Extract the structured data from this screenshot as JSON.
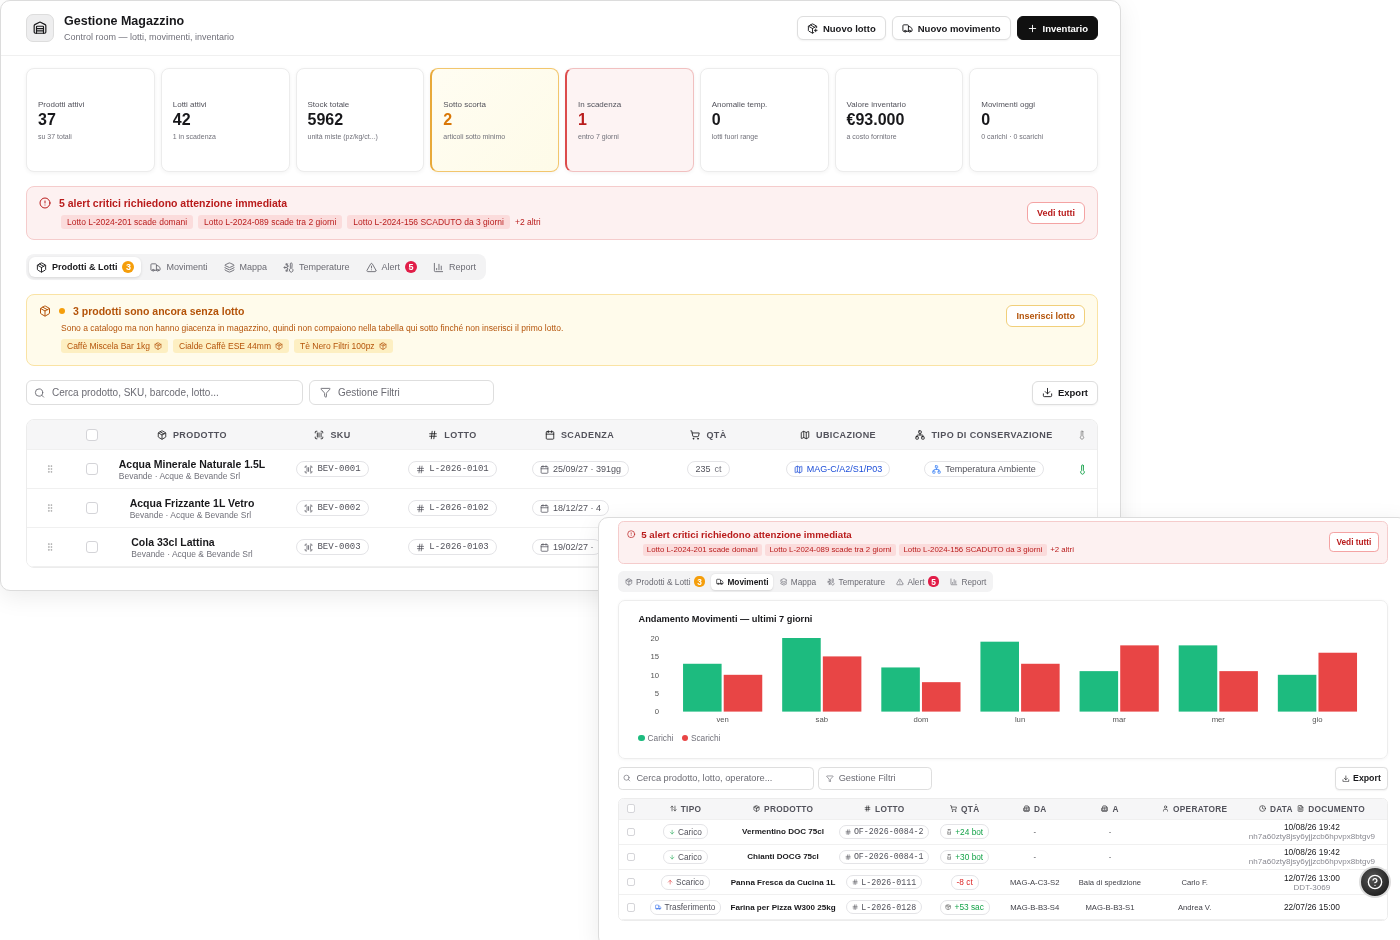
{
  "main_window": {
    "title": "Gestione Magazzino",
    "subtitle": "Control room — lotti, movimenti, inventario",
    "actions": [
      {
        "label": "Nuovo lotto",
        "kind": "outline"
      },
      {
        "label": "Nuovo movimento",
        "kind": "outline"
      },
      {
        "label": "Inventario",
        "kind": "primary"
      }
    ],
    "stats": [
      {
        "label": "Prodotti attivi",
        "value": "37",
        "note": "su 37 totali",
        "kind": "normal"
      },
      {
        "label": "Lotti attivi",
        "value": "42",
        "note": "1 in scadenza",
        "kind": "normal"
      },
      {
        "label": "Stock totale",
        "value": "5962",
        "note": "unità miste (pz/kg/ct...)",
        "kind": "normal"
      },
      {
        "label": "Sotto scorta",
        "value": "2",
        "note": "articoli sotto minimo",
        "kind": "warning"
      },
      {
        "label": "In scadenza",
        "value": "1",
        "note": "entro 7 giorni",
        "kind": "danger"
      },
      {
        "label": "Anomalie temp.",
        "value": "0",
        "note": "lotti fuori range",
        "kind": "normal"
      },
      {
        "label": "Valore inventario",
        "value": "€93.000",
        "note": "a costo fornitore",
        "kind": "normal"
      },
      {
        "label": "Movimenti oggi",
        "value": "0",
        "note": "0 carichi · 0 scarichi",
        "kind": "normal"
      }
    ],
    "alert": {
      "title": "5 alert critici richiedono attenzione immediata",
      "chips": [
        "Lotto L-2024-201 scade domani",
        "Lotto L-2024-089 scade tra 2 giorni",
        "Lotto L-2024-156 SCADUTO da 3 giorni"
      ],
      "more": "+2 altri",
      "button": "Vedi tutti"
    },
    "tabs": [
      {
        "label": "Prodotti & Lotti",
        "selected": true,
        "badge": {
          "text": "3",
          "color": "#f59e0b"
        }
      },
      {
        "label": "Movimenti",
        "selected": false
      },
      {
        "label": "Mappa",
        "selected": false
      },
      {
        "label": "Temperature",
        "selected": false
      },
      {
        "label": "Alert",
        "selected": false,
        "badge": {
          "text": "5",
          "color": "#e11d48"
        }
      },
      {
        "label": "Report",
        "selected": false
      }
    ],
    "notice": {
      "title": "3 prodotti sono ancora senza lotto",
      "text": "Sono a catalogo ma non hanno giacenza in magazzino, quindi non compaiono nella tabella qui sotto finché non inserisci il primo lotto.",
      "chips": [
        "Caffè Miscela Bar 1kg",
        "Cialde Caffè ESE 44mm",
        "Tè Nero Filtri 100pz"
      ],
      "button": "Inserisci lotto"
    },
    "search": {
      "placeholder": "Cerca prodotto, SKU, barcode, lotto..."
    },
    "filter": "Gestione Filtri",
    "export": "Export",
    "table": {
      "all_checked": false,
      "columns": [
        "PRODOTTO",
        "SKU",
        "LOTTO",
        "SCADENZA",
        "QTÀ",
        "UBICAZIONE",
        "TIPO DI CONSERVAZIONE"
      ],
      "rows": [
        {
          "checked": false,
          "product": "Acqua Minerale Naturale 1.5L",
          "supplier": "Bevande · Acque & Bevande Srl",
          "sku": "BEV-0001",
          "lot": "L-2026-0101",
          "expiry": "25/09/27 · 391gg",
          "qty": "235",
          "unit": "ct",
          "location": "MAG-C/A2/S1/P03",
          "storage": "Temperatura Ambiente"
        },
        {
          "checked": false,
          "product": "Acqua Frizzante 1L Vetro",
          "supplier": "Bevande · Acque & Bevande Srl",
          "sku": "BEV-0002",
          "lot": "L-2026-0102",
          "expiry": "18/12/27 · 4"
        },
        {
          "checked": false,
          "product": "Cola 33cl Lattina",
          "supplier": "Bevande · Acque & Bevande Srl",
          "sku": "BEV-0003",
          "lot": "L-2026-0103",
          "expiry": "19/02/27 ·"
        }
      ]
    }
  },
  "second_window": {
    "alert": {
      "title": "5 alert critici richiedono attenzione immediata",
      "chips": [
        "Lotto L-2024-201 scade domani",
        "Lotto L-2024-089 scade tra 2 giorni",
        "Lotto L-2024-156 SCADUTO da 3 giorni"
      ],
      "more": "+2 altri",
      "button": "Vedi tutti"
    },
    "tabs": [
      {
        "label": "Prodotti & Lotti",
        "selected": false,
        "badge": {
          "text": "3",
          "color": "#f59e0b"
        }
      },
      {
        "label": "Movimenti",
        "selected": true
      },
      {
        "label": "Mappa",
        "selected": false
      },
      {
        "label": "Temperature",
        "selected": false
      },
      {
        "label": "Alert",
        "selected": false,
        "badge": {
          "text": "5",
          "color": "#e11d48"
        }
      },
      {
        "label": "Report",
        "selected": false
      }
    ],
    "chart": {
      "chart_data": {
        "type": "bar",
        "title": "Andamento Movimenti — ultimi 7 giorni",
        "categories": [
          "ven",
          "sab",
          "dom",
          "lun",
          "mar",
          "mer",
          "gio"
        ],
        "series": [
          {
            "name": "Carichi",
            "color": "#1dbb7f",
            "values": [
              13,
              20,
              12,
              19,
              11,
              18,
              10
            ]
          },
          {
            "name": "Scarichi",
            "color": "#e84545",
            "values": [
              10,
              15,
              8,
              13,
              18,
              11,
              16
            ]
          }
        ],
        "ylim": [
          0,
          20
        ],
        "yticks": [
          0,
          5,
          10,
          15,
          20
        ],
        "legend": "bottom"
      }
    },
    "search": {
      "placeholder": "Cerca prodotto, lotto, operatore..."
    },
    "filter": "Gestione Filtri",
    "export": "Export",
    "table": {
      "all_checked": false,
      "columns": [
        "TIPO",
        "PRODOTTO",
        "LOTTO",
        "QTÀ",
        "DA",
        "A",
        "OPERATORE",
        "DATA",
        "DOCUMENTO"
      ],
      "rows": [
        {
          "checked": false,
          "kind": "in",
          "type": "Carico",
          "product": "Vermentino DOC 75cl",
          "lot": "OF-2026-0084-2",
          "qty": "+24 bot",
          "from": "-",
          "to": "-",
          "date": "10/08/26 19:42",
          "document": "nh7a60zty8jsy6yjjzcb6hpvpx8btgv9"
        },
        {
          "checked": false,
          "kind": "in",
          "type": "Carico",
          "product": "Chianti DOCG 75cl",
          "lot": "OF-2026-0084-1",
          "qty": "+30 bot",
          "from": "-",
          "to": "-",
          "date": "10/08/26 19:42",
          "document": "nh7a60zty8jsy6yjjzcb6hpvpx8btgv9"
        },
        {
          "checked": false,
          "kind": "out",
          "type": "Scarico",
          "product": "Panna Fresca da Cucina 1L",
          "lot": "L-2026-0111",
          "qty": "-8 ct",
          "from": "MAG-A-C3-S2",
          "to": "Baia di spedizione",
          "operator": "Carlo F.",
          "date": "12/07/26 13:00",
          "document": "DDT-3069"
        },
        {
          "checked": false,
          "kind": "transfer",
          "type": "Trasferimento",
          "product": "Farina per Pizza W300 25kg",
          "lot": "L-2026-0128",
          "qty": "+53 sac",
          "from": "MAG-B-B3-S4",
          "to": "MAG-B-B3-S1",
          "operator": "Andrea V.",
          "date": "22/07/26 15:00"
        }
      ]
    }
  }
}
